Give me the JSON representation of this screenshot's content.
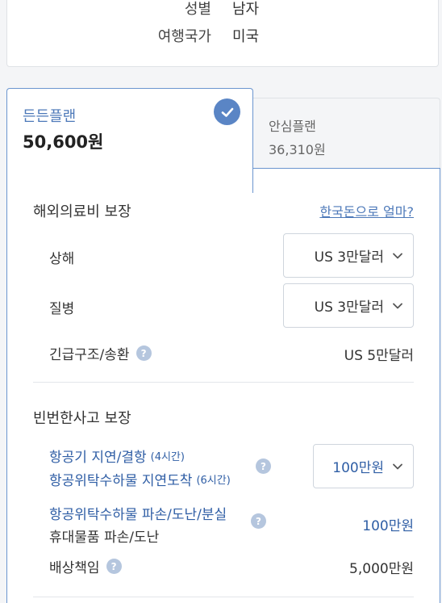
{
  "info": {
    "gender_label": "성별",
    "gender_value": "남자",
    "country_label": "여행국가",
    "country_value": "미국"
  },
  "plans": [
    {
      "name": "든든플랜",
      "price": "50,600원",
      "selected": true
    },
    {
      "name": "안심플랜",
      "price": "36,310원",
      "selected": false
    }
  ],
  "medical": {
    "title": "해외의료비 보장",
    "link": "한국돈으로 얼마?",
    "injury_label": "상해",
    "injury_value": "US 3만달러",
    "illness_label": "질병",
    "illness_value": "US 3만달러",
    "rescue_label": "긴급구조/송환",
    "rescue_value": "US 5만달러"
  },
  "frequent": {
    "title": "빈번한사고 보장",
    "flight_delay_label": "항공기 지연/결항",
    "flight_delay_note": "(4시간)",
    "baggage_delay_label": "항공위탁수하물 지연도착",
    "baggage_delay_note": "(6시간)",
    "delay_value": "100만원",
    "baggage_damage_label": "항공위탁수하물 파손/도난/분실",
    "carry_damage_label": "휴대물품 파손/도난",
    "damage_value": "100만원",
    "liability_label": "배상책임",
    "liability_value": "5,000만원"
  },
  "icons": {
    "check": "check-icon",
    "help": "question-icon",
    "chevron": "chevron-down-icon"
  },
  "colors": {
    "accent": "#4d79b9",
    "accent_dark": "#2f5ea5",
    "border_active": "#6b95cf"
  }
}
